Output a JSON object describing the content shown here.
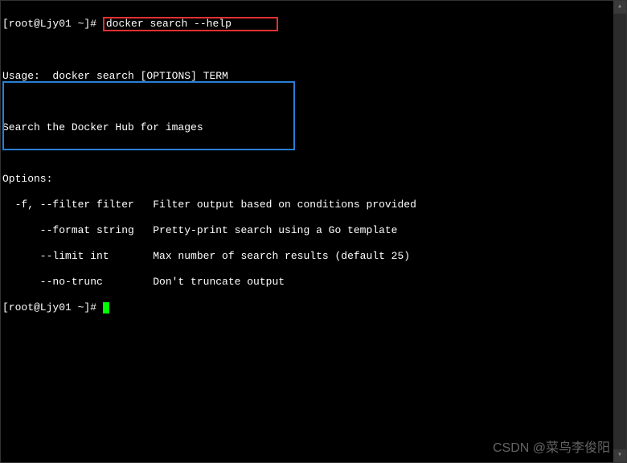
{
  "prompt1": {
    "user_host": "[root@Ljy01 ~]#",
    "command": "docker search --help"
  },
  "output": {
    "usage_label": "Usage:",
    "usage_text": "  docker search [OPTIONS] TERM",
    "description": "Search the Docker Hub for images",
    "options_header": "Options:",
    "options": [
      {
        "flag": "  -f, --filter filter",
        "desc": "   Filter output based on conditions provided"
      },
      {
        "flag": "      --format string",
        "desc": "   Pretty-print search using a Go template"
      },
      {
        "flag": "      --limit int    ",
        "desc": "   Max number of search results (default 25)"
      },
      {
        "flag": "      --no-trunc     ",
        "desc": "   Don't truncate output"
      }
    ]
  },
  "prompt2": {
    "user_host": "[root@Ljy01 ~]#"
  },
  "watermark": "CSDN @菜鸟李俊阳"
}
